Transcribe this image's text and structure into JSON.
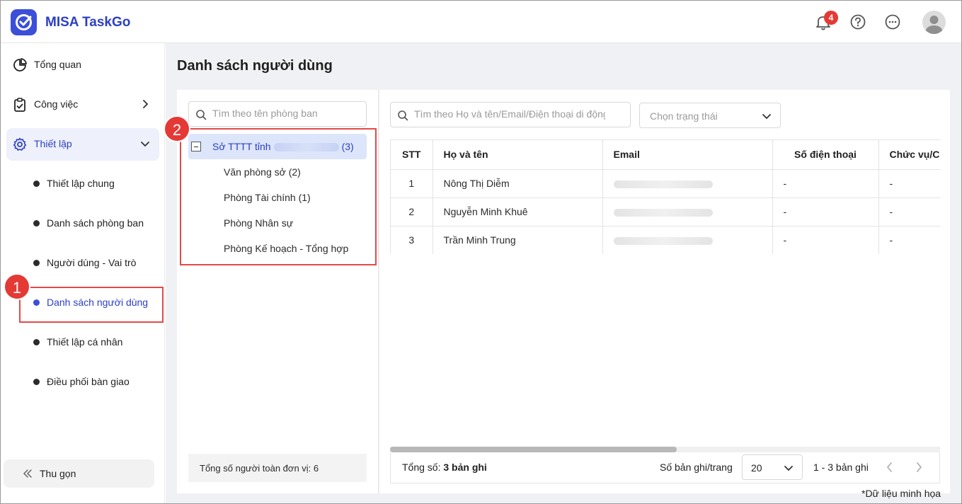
{
  "app": {
    "name": "MISA TaskGo",
    "notification_count": "4"
  },
  "sidebar": {
    "items": [
      {
        "label": "Tổng quan"
      },
      {
        "label": "Công việc"
      },
      {
        "label": "Thiết lập"
      }
    ],
    "sub_items": [
      {
        "label": "Thiết lập chung"
      },
      {
        "label": "Danh sách phòng ban"
      },
      {
        "label": "Người dùng - Vai trò"
      },
      {
        "label": "Danh sách người dùng"
      },
      {
        "label": "Thiết lập cá nhân"
      },
      {
        "label": "Điều phối bàn giao"
      }
    ],
    "collapse_label": "Thu gọn"
  },
  "page": {
    "title": "Danh sách người dùng"
  },
  "departments": {
    "search_placeholder": "Tìm theo tên phòng ban",
    "root": {
      "label": "Sở TTTT tỉnh",
      "count": "(3)"
    },
    "children": [
      {
        "label": "Văn phòng sở  (2)"
      },
      {
        "label": "Phòng Tài chính  (1)"
      },
      {
        "label": "Phòng Nhân sự"
      },
      {
        "label": "Phòng Kế hoạch - Tổng hợp"
      }
    ],
    "footer": "Tổng số người toàn đơn vị: 6"
  },
  "users": {
    "search_placeholder": "Tìm theo Họ và tên/Email/Điện thoại di động",
    "status_placeholder": "Chọn trạng thái",
    "columns": [
      "STT",
      "Họ và tên",
      "Email",
      "Số điện thoại",
      "Chức vụ/C"
    ],
    "rows": [
      {
        "stt": "1",
        "name": "Nông Thị Diễm",
        "phone": "-",
        "position": "-"
      },
      {
        "stt": "2",
        "name": "Nguyễn Minh Khuê",
        "phone": "-",
        "position": "-"
      },
      {
        "stt": "3",
        "name": "Trần Minh Trung",
        "phone": "-",
        "position": "-"
      }
    ],
    "footer": {
      "total_prefix": "Tổng số: ",
      "total_value": "3 bản ghi",
      "per_page_label": "Số bản ghi/trang",
      "per_page_value": "20",
      "range": "1 - 3 bản ghi"
    }
  },
  "annotations": {
    "step1": "1",
    "step2": "2"
  },
  "footnote": "*Dữ liệu minh họa",
  "colors": {
    "brand": "#3b4fd8",
    "highlight": "#e24a4a",
    "active_bg": "#eef0fb"
  }
}
